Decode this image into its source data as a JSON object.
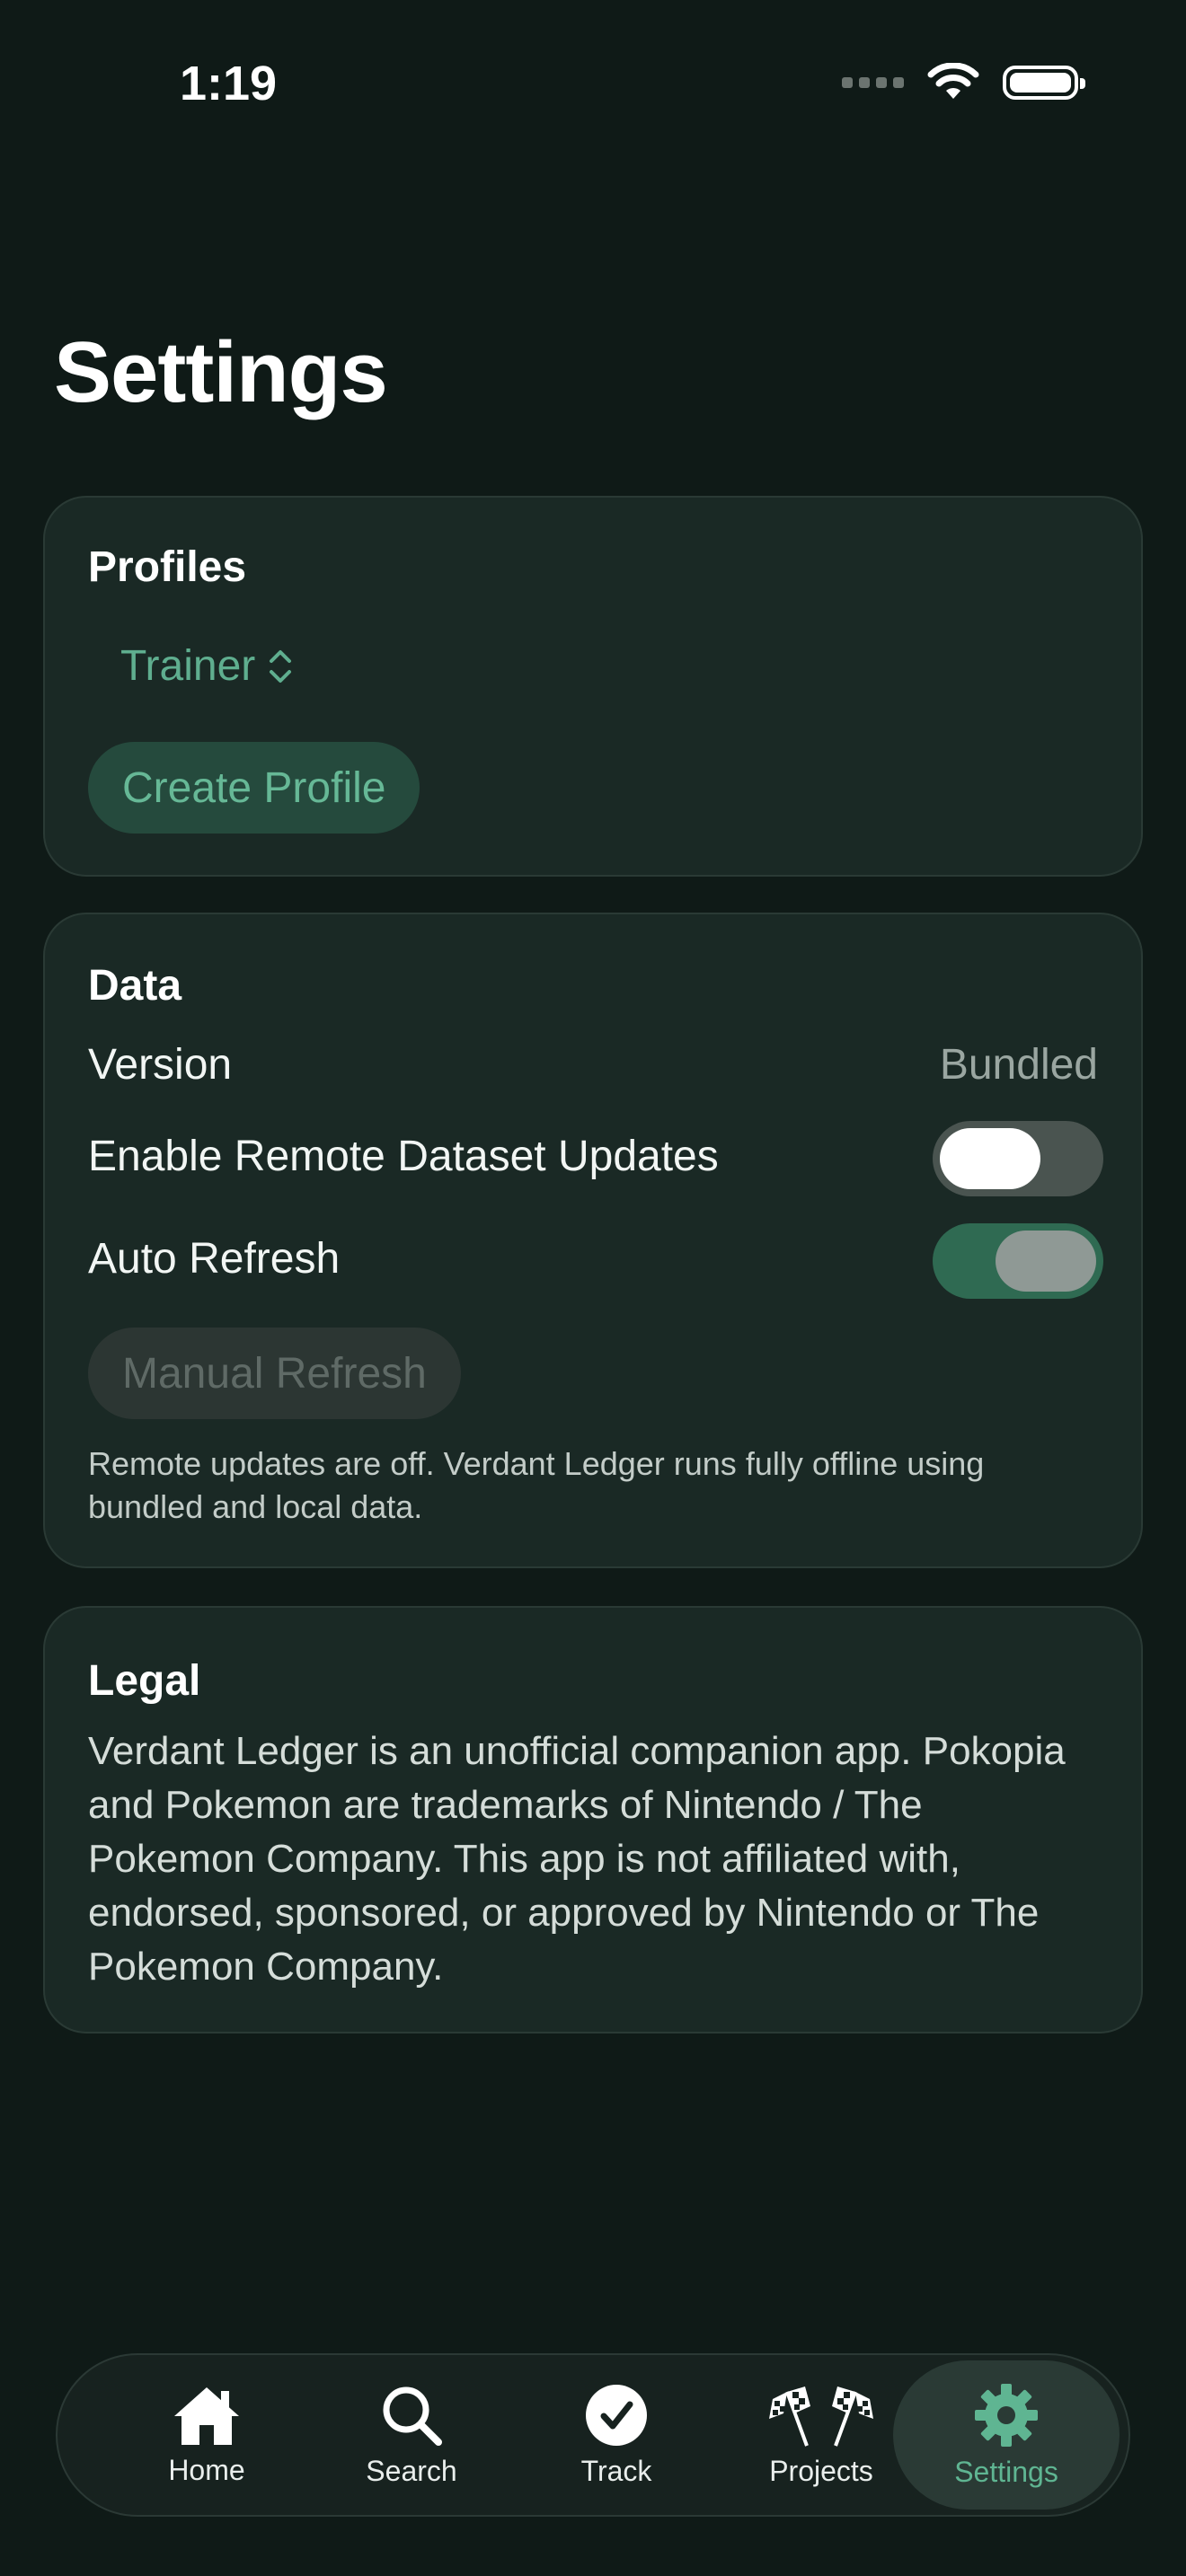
{
  "status_bar": {
    "time": "1:19"
  },
  "page": {
    "title": "Settings"
  },
  "profiles": {
    "title": "Profiles",
    "selected_profile": "Trainer",
    "create_label": "Create Profile"
  },
  "data_section": {
    "title": "Data",
    "version_label": "Version",
    "version_value": "Bundled",
    "remote_updates_label": "Enable Remote Dataset Updates",
    "remote_updates_on": false,
    "auto_refresh_label": "Auto Refresh",
    "auto_refresh_on": true,
    "manual_refresh_label": "Manual Refresh",
    "note": "Remote updates are off. Verdant Ledger runs fully offline using bundled and local data."
  },
  "legal": {
    "title": "Legal",
    "text": "Verdant Ledger is an unofficial companion app. Pokopia and Pokemon are trademarks of Nintendo / The Pokemon Company. This app is not affiliated with, endorsed, sponsored, or approved by Nintendo or The Pokemon Company."
  },
  "tabs": [
    {
      "label": "Home",
      "icon": "home-icon"
    },
    {
      "label": "Search",
      "icon": "search-icon"
    },
    {
      "label": "Track",
      "icon": "checkmark-circle-icon"
    },
    {
      "label": "Projects",
      "icon": "checkered-flags-icon"
    },
    {
      "label": "Settings",
      "icon": "gear-icon",
      "active": true
    }
  ],
  "colors": {
    "background": "#0f1a17",
    "card": "#1a2925",
    "accent": "#5fb592"
  }
}
